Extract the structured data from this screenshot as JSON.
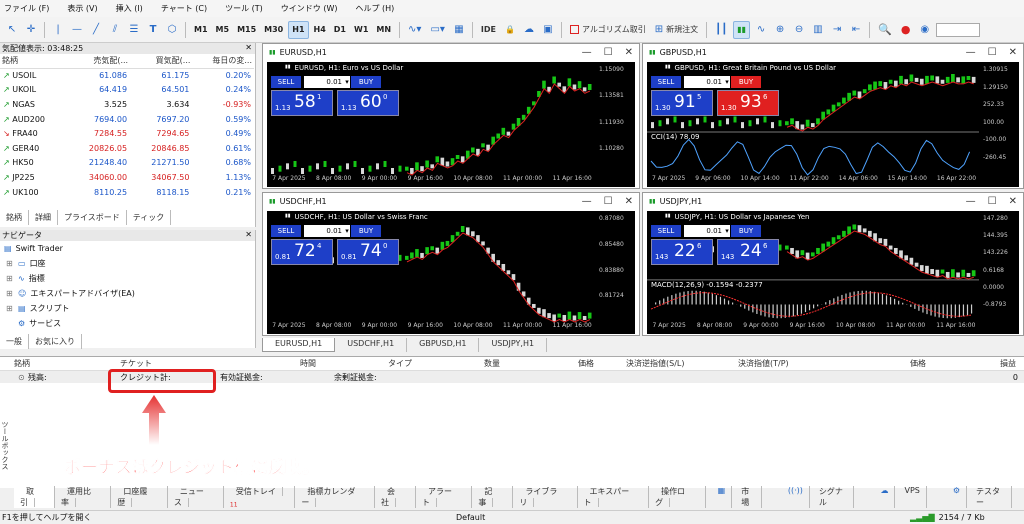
{
  "menu": [
    "ファイル (F)",
    "表示 (V)",
    "挿入 (I)",
    "チャート (C)",
    "ツール (T)",
    "ウインドウ (W)",
    "ヘルプ (H)"
  ],
  "toolbar": {
    "timeframes": [
      "M1",
      "M5",
      "M15",
      "M30",
      "H1",
      "H4",
      "D1",
      "W1",
      "MN"
    ],
    "active_timeframe": "H1",
    "ide": "IDE",
    "algo": "アルゴリズム取引",
    "new_order": "新規注文"
  },
  "market_watch": {
    "title": "気配値表示: 03:48:25",
    "headers": [
      "銘柄",
      "売気配(...",
      "買気配(...",
      "毎日の変..."
    ],
    "rows": [
      {
        "symbol": "USOIL",
        "bid": "61.086",
        "ask": "61.175",
        "change": "0.20%",
        "dir": "up",
        "color": "blue"
      },
      {
        "symbol": "UKOIL",
        "bid": "64.419",
        "ask": "64.501",
        "change": "0.24%",
        "dir": "up",
        "color": "blue"
      },
      {
        "symbol": "NGAS",
        "bid": "3.525",
        "ask": "3.634",
        "change": "-0.93%",
        "dir": "up",
        "color": "black"
      },
      {
        "symbol": "AUD200",
        "bid": "7694.00",
        "ask": "7697.20",
        "change": "0.59%",
        "dir": "up",
        "color": "blue"
      },
      {
        "symbol": "FRA40",
        "bid": "7284.55",
        "ask": "7294.65",
        "change": "0.49%",
        "dir": "dn",
        "color": "red"
      },
      {
        "symbol": "GER40",
        "bid": "20826.05",
        "ask": "20846.85",
        "change": "0.61%",
        "dir": "up",
        "color": "red"
      },
      {
        "symbol": "HK50",
        "bid": "21248.40",
        "ask": "21271.50",
        "change": "0.68%",
        "dir": "up",
        "color": "blue"
      },
      {
        "symbol": "JP225",
        "bid": "34060.00",
        "ask": "34067.50",
        "change": "1.13%",
        "dir": "up",
        "color": "red"
      },
      {
        "symbol": "UK100",
        "bid": "8110.25",
        "ask": "8118.15",
        "change": "0.21%",
        "dir": "up",
        "color": "blue"
      }
    ],
    "tabs": [
      "銘柄",
      "詳細",
      "プライスボード",
      "ティック"
    ]
  },
  "navigator": {
    "title": "ナビゲータ",
    "root": "Swift Trader",
    "items": [
      "口座",
      "指標",
      "エキスパートアドバイザ(EA)",
      "スクリプト",
      "サービス"
    ],
    "tabs": [
      "一般",
      "お気に入り"
    ]
  },
  "charts": [
    {
      "window": "EURUSD,H1",
      "title": "EURUSD, H1:  Euro vs US Dollar",
      "lot": "0.01",
      "sell_small": "1.13",
      "sell_big": "58",
      "sell_sup": "1",
      "buy_small": "1.13",
      "buy_big": "60",
      "buy_sup": "0",
      "prices": [
        "1.15090",
        "1.13581",
        "1.11930",
        "1.10280"
      ],
      "times": [
        "7 Apr 2025",
        "8 Apr 08:00",
        "9 Apr 00:00",
        "9 Apr 16:00",
        "10 Apr 08:00",
        "11 Apr 00:00",
        "11 Apr 16:00"
      ],
      "trend": [
        8,
        7,
        9,
        8,
        10,
        9,
        12,
        11,
        10,
        11,
        13,
        12,
        14,
        16,
        15,
        18,
        17,
        20,
        22,
        24,
        23,
        26,
        28,
        30,
        33,
        36,
        40,
        44,
        42,
        46,
        44,
        42,
        45,
        43,
        44,
        42,
        43
      ]
    },
    {
      "window": "GBPUSD,H1",
      "title": "GBPUSD, H1:  Great Britain Pound vs US Dollar",
      "lot": "0.01",
      "sell_small": "1.30",
      "sell_big": "91",
      "sell_sup": "5",
      "buy_small": "1.30",
      "buy_big": "93",
      "buy_sup": "6",
      "prices": [
        "1.30915",
        "1.29150",
        "252.33",
        "100.00",
        "-100.00",
        "-260.45"
      ],
      "cci": "CCI(14) 78.09",
      "times": [
        "7 Apr 2025",
        "9 Apr 06:00",
        "10 Apr 14:00",
        "11 Apr 22:00",
        "14 Apr 06:00",
        "15 Apr 14:00",
        "16 Apr 22:00"
      ],
      "trend": [
        10,
        11,
        9,
        8,
        10,
        9,
        11,
        14,
        16,
        18,
        20,
        22,
        24,
        26,
        25,
        27,
        29,
        30,
        31,
        30,
        32,
        31,
        33,
        32,
        34,
        33,
        32,
        33,
        34,
        33,
        32,
        33,
        34,
        33,
        33,
        34,
        33
      ]
    },
    {
      "window": "USDCHF,H1",
      "title": "USDCHF, H1:  US Dollar vs Swiss Franc",
      "lot": "0.01",
      "sell_small": "0.81",
      "sell_big": "72",
      "sell_sup": "4",
      "buy_small": "0.81",
      "buy_big": "74",
      "buy_sup": "0",
      "prices": [
        "0.87080",
        "0.85480",
        "0.83880",
        "0.81724"
      ],
      "times": [
        "7 Apr 2025",
        "8 Apr 08:00",
        "9 Apr 00:00",
        "9 Apr 16:00",
        "10 Apr 08:00",
        "11 Apr 00:00",
        "11 Apr 16:00"
      ],
      "trend": [
        30,
        31,
        32,
        31,
        33,
        34,
        33,
        35,
        36,
        38,
        40,
        42,
        41,
        40,
        38,
        36,
        33,
        30,
        28,
        26,
        24,
        22,
        18,
        15,
        12,
        10,
        8,
        7,
        6,
        5,
        6,
        5,
        6,
        5,
        6,
        5,
        6
      ]
    },
    {
      "window": "USDJPY,H1",
      "title": "USDJPY, H1:  US Dollar vs Japanese Yen",
      "lot": "0.01",
      "sell_small": "143",
      "sell_big": "22",
      "sell_sup": "6",
      "buy_small": "143",
      "buy_big": "24",
      "buy_sup": "6",
      "prices": [
        "147.280",
        "144.395",
        "143.226",
        "0.6168",
        "0.0000",
        "-0.8793"
      ],
      "macd": "MACD(12,26,9) -0.1594 -0.2377",
      "times": [
        "7 Apr 2025",
        "8 Apr 08:00",
        "9 Apr 00:00",
        "9 Apr 16:00",
        "10 Apr 08:00",
        "11 Apr 00:00",
        "11 Apr 16:00"
      ],
      "trend": [
        30,
        28,
        26,
        27,
        25,
        26,
        28,
        30,
        32,
        34,
        36,
        38,
        40,
        42,
        41,
        40,
        38,
        36,
        34,
        33,
        30,
        28,
        26,
        24,
        22,
        20,
        18,
        17,
        16,
        15,
        16,
        14,
        15,
        14,
        15,
        14,
        15
      ]
    }
  ],
  "chart_tabs": [
    "EURUSD,H1",
    "USDCHF,H1",
    "GBPUSD,H1",
    "USDJPY,H1"
  ],
  "terminal": {
    "headers": [
      "銘柄",
      "チケット",
      "時間",
      "タイプ",
      "数量",
      "価格",
      "決済逆指値(S/L)",
      "決済指値(T/P)",
      "価格",
      "損益"
    ],
    "balance_label": "残高:",
    "credit_label": "クレジット計:",
    "equity_label": "有効証拠金:",
    "free_margin_label": "余剰証拠金:",
    "profit": "0",
    "side_label": "ツールボックス",
    "annotation": "ボーナスはクレジット欄に反映。",
    "tabs": [
      "取引",
      "運用比率",
      "口座履歴",
      "ニュース",
      "受信トレイ",
      "指標カレンダー",
      "会社",
      "アラート",
      "記事",
      "ライブラリ",
      "エキスパート",
      "操作ログ"
    ],
    "inbox_count": "11",
    "right": [
      "市場",
      "シグナル",
      "VPS",
      "テスター"
    ]
  },
  "status": {
    "help": "F1を押してヘルプを開く",
    "profile": "Default",
    "traffic": "2154 / 7 Kb"
  }
}
